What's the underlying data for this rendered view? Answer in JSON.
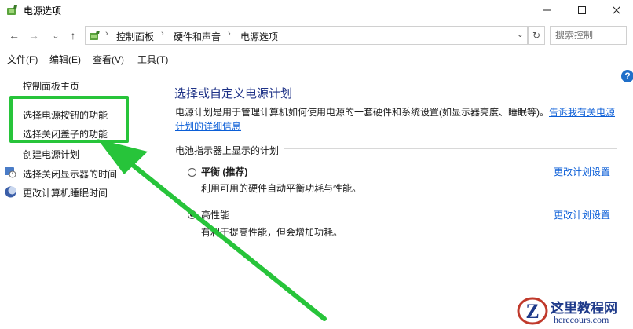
{
  "window": {
    "title": "电源选项"
  },
  "nav": {
    "back": "←",
    "forward": "→",
    "recent": "⌄",
    "up": "↑",
    "breadcrumb": [
      "控制面板",
      "硬件和声音",
      "电源选项"
    ],
    "search_placeholder": "搜索控制"
  },
  "menu": [
    "文件(F)",
    "编辑(E)",
    "查看(V)",
    "工具(T)"
  ],
  "sidebar": {
    "home": "控制面板主页",
    "links": [
      "选择电源按钮的功能",
      "选择关闭盖子的功能",
      "创建电源计划",
      "选择关闭显示器的时间",
      "更改计算机睡眠时间"
    ]
  },
  "main": {
    "title": "选择或自定义电源计划",
    "description": "电源计划是用于管理计算机如何使用电源的一套硬件和系统设置(如显示器亮度、睡眠等)。",
    "description_link": "告诉我有关电源计划的详细信息",
    "section": "电池指示器上显示的计划",
    "plans": [
      {
        "name": "平衡 (推荐)",
        "desc": "利用可用的硬件自动平衡功耗与性能。",
        "link": "更改计划设置",
        "selected": false
      },
      {
        "name": "高性能",
        "desc": "有利于提高性能，但会增加功耗。",
        "link": "更改计划设置",
        "selected": true
      }
    ]
  },
  "help": "?",
  "watermark": {
    "text": "这里教程网",
    "url": "herecours.com"
  },
  "colors": {
    "highlight": "#27c43a",
    "link": "#0b5ed7",
    "title": "#1e3287"
  }
}
